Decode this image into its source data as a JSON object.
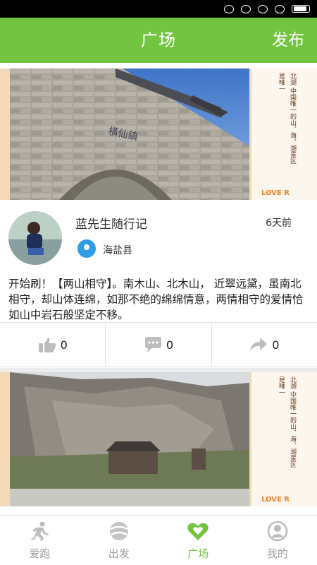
{
  "header": {
    "title": "广场",
    "publish_label": "发布"
  },
  "colors": {
    "accent": "#73c440",
    "location": "#2e9de4",
    "icon_gray": "#bdbdbd"
  },
  "posts": [
    {
      "image": {
        "side_text_1": "是唯一",
        "side_text_2": "北湖 中国唯一的山、海、湖景区",
        "logo": "LOVE R"
      },
      "author": "蓝先生随行记",
      "time_ago": "6天前",
      "location": "海盐县",
      "text": "开始刷！【两山相守】。南木山、北木山， 近翠远黛，虽南北相守，却山体连绵，如那不绝的绵绵情意，两情相守的爱情恰如山中岩石般坚定不移。",
      "likes": "0",
      "comments": "0",
      "shares": "0"
    },
    {
      "image": {
        "side_text_1": "是唯一",
        "side_text_2": "北湖 中国唯一的山、海、湖景区",
        "logo": "LOVE R"
      }
    }
  ],
  "tabs": [
    {
      "label": "爱跑",
      "icon": "runner-icon"
    },
    {
      "label": "出发",
      "icon": "ball-icon"
    },
    {
      "label": "广场",
      "icon": "hearts-icon"
    },
    {
      "label": "我的",
      "icon": "user-icon"
    }
  ]
}
